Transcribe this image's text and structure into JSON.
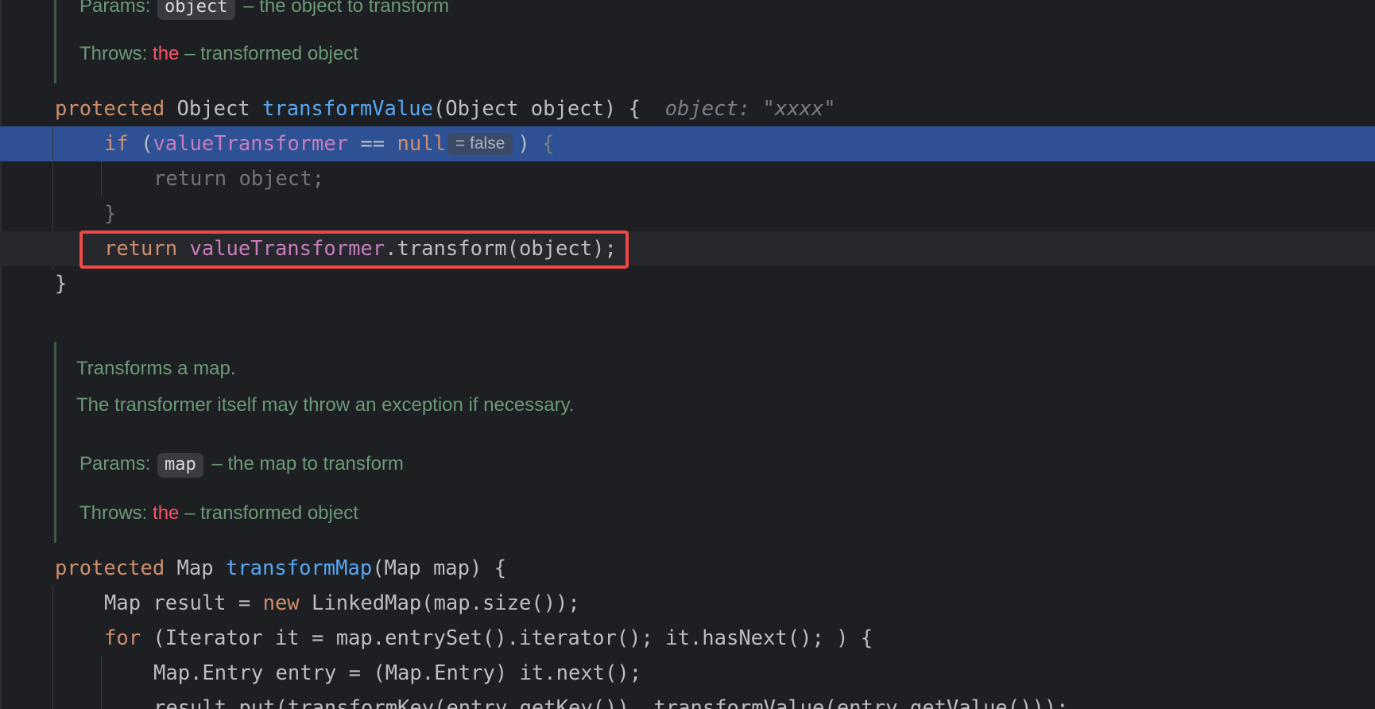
{
  "doc1": {
    "params_label": "Params:",
    "params_chip": "object",
    "params_text": "– the object to transform",
    "throws_label": "Throws:",
    "throws_red": "the",
    "throws_text": "– transformed object"
  },
  "method1": {
    "modifier": "protected",
    "return_type": "Object",
    "name": "transformValue",
    "signature_rest": "(Object object) {",
    "hint": "object: \"xxxx\"",
    "if_kw": "if",
    "if_open": " (",
    "field": "valueTransformer",
    "op": " == ",
    "null_kw": "null",
    "inlay": "= false",
    "if_close": ")",
    "brace": "{",
    "inner_return": "return object;",
    "close_brace_inner": "}",
    "return_kw": "return",
    "return_field": "valueTransformer",
    "return_rest": ".transform(object);",
    "close_brace": "}"
  },
  "doc2": {
    "line1": "Transforms a map.",
    "line2": "The transformer itself may throw an exception if necessary.",
    "params_label": "Params:",
    "params_chip": "map",
    "params_text": "– the map to transform",
    "throws_label": "Throws:",
    "throws_red": "the",
    "throws_text": "– transformed object"
  },
  "method2": {
    "modifier": "protected",
    "return_type": "Map",
    "name": "transformMap",
    "signature_rest": "(Map map) {",
    "line1_prefix": "Map result = ",
    "line1_new": "new",
    "line1_rest": " LinkedMap(map.size());",
    "line2_for": "for",
    "line2_rest": " (Iterator it = map.entrySet().iterator(); it.hasNext(); ) {",
    "line3": "Map.Entry entry = (Map.Entry) it.next();",
    "line4": "result.put(transformKey(entry.getKey()), transformValue(entry.getValue()));"
  },
  "colors": {
    "background": "#1e1f22",
    "selection": "#2d5194",
    "keyword": "#cf8e6d",
    "function": "#56a8f5",
    "field": "#c77dbb",
    "doc_comment": "#6a9a78",
    "error_red": "#f75464",
    "annotation_box": "#ef4845"
  }
}
